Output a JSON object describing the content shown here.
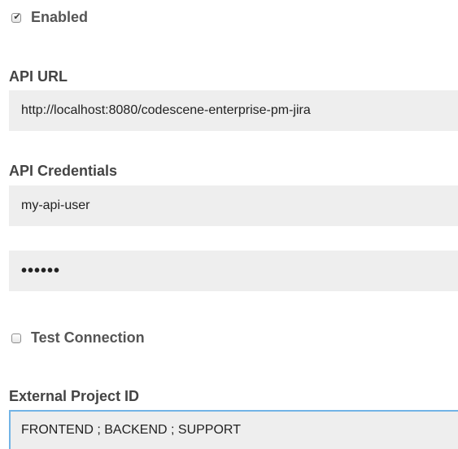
{
  "enabled": {
    "label": "Enabled",
    "checked": true,
    "check_glyph": "✔"
  },
  "api_url": {
    "label": "API URL",
    "value": "http://localhost:8080/codescene-enterprise-pm-jira"
  },
  "api_credentials": {
    "label": "API Credentials",
    "username": "my-api-user",
    "password_masked": "••••••"
  },
  "test_connection": {
    "label": "Test Connection",
    "checked": false
  },
  "external_project_id": {
    "label": "External Project ID",
    "value": "FRONTEND ; BACKEND ; SUPPORT"
  },
  "colors": {
    "focus_border": "#72b4e6",
    "input_background": "#eeeeee"
  }
}
